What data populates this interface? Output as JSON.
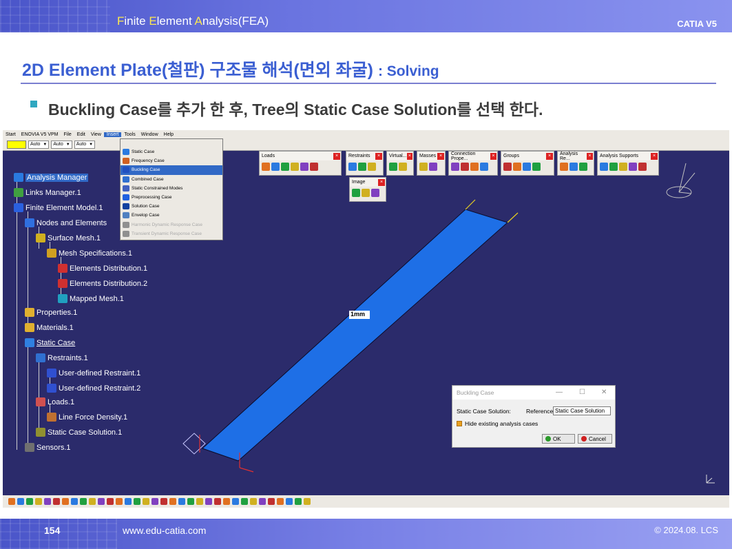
{
  "header": {
    "title_parts": [
      {
        "text": "F",
        "hl": true
      },
      {
        "text": "inite ",
        "hl": false
      },
      {
        "text": "E",
        "hl": true
      },
      {
        "text": "lement ",
        "hl": false
      },
      {
        "text": "A",
        "hl": true
      },
      {
        "text": "nalysis(FEA)",
        "hl": false
      }
    ],
    "product": "CATIA V5"
  },
  "slide": {
    "title": "2D Element Plate(철판) 구조물 해석(면외 좌굴) ",
    "title_suffix": ": Solving",
    "bullet": "Buckling Case를 추가 한 후, Tree의 Static Case Solution를 선택 한다."
  },
  "catia": {
    "menubar": [
      "Start",
      "ENOVIA V5 VPM",
      "File",
      "Edit",
      "View",
      "Insert",
      "Tools",
      "Window",
      "Help"
    ],
    "active_menu": "Insert",
    "toolbar": {
      "combo1": "Auto",
      "combo2": "Auto",
      "combo3": "Auto"
    },
    "insert_menu": [
      {
        "label": "Static Case",
        "state": "normal"
      },
      {
        "label": "Frequency Case",
        "state": "normal"
      },
      {
        "label": "Buckling Case",
        "state": "selected"
      },
      {
        "label": "Combined Case",
        "state": "normal"
      },
      {
        "label": "Static Constrained Modes",
        "state": "normal"
      },
      {
        "label": "Preprocessing Case",
        "state": "normal"
      },
      {
        "label": "Solution Case",
        "state": "normal"
      },
      {
        "label": "Envelop Case",
        "state": "normal"
      },
      {
        "label": "Harmonic Dynamic Response Case",
        "state": "disabled"
      },
      {
        "label": "Transient Dynamic Response Case",
        "state": "disabled"
      }
    ],
    "toolbars": [
      "Loads",
      "Restraints",
      "Virtual...",
      "Masses",
      "Connection Prope...",
      "Groups",
      "Analysis Re...",
      "Analysis Supports",
      "Image"
    ],
    "tree": [
      {
        "label": "Analysis Manager",
        "state": "selected"
      },
      {
        "label": "Links Manager.1"
      },
      {
        "label": "Finite Element Model.1"
      },
      {
        "label": "Nodes and Elements"
      },
      {
        "label": "Surface Mesh.1"
      },
      {
        "label": "Mesh Specifications.1"
      },
      {
        "label": "Elements Distribution.1"
      },
      {
        "label": "Elements Distribution.2"
      },
      {
        "label": "Mapped Mesh.1"
      },
      {
        "label": "Properties.1"
      },
      {
        "label": "Materials.1"
      },
      {
        "label": "Static Case",
        "underline": true
      },
      {
        "label": "Restraints.1"
      },
      {
        "label": "User-defined Restraint.1"
      },
      {
        "label": "User-defined Restraint.2"
      },
      {
        "label": "Loads.1"
      },
      {
        "label": "Line Force Density.1"
      },
      {
        "label": "Static Case Solution.1"
      },
      {
        "label": "Sensors.1"
      }
    ],
    "dimension_label": "1mm",
    "dialog": {
      "title": "Buckling Case",
      "field_label": "Static Case Solution:",
      "reference_label": "Reference",
      "field_value": "Static Case Solution",
      "checkbox_label": "Hide existing analysis cases",
      "ok": "OK",
      "cancel": "Cancel"
    }
  },
  "footer": {
    "page": "154",
    "site": "www.edu-catia.com",
    "copyright": "© 2024.08. LCS"
  },
  "colors": {
    "viewport_bg": "#2b2b6b",
    "plate": "#1e6fe6",
    "header": "#4a55c9",
    "title": "#3b5fd2"
  }
}
